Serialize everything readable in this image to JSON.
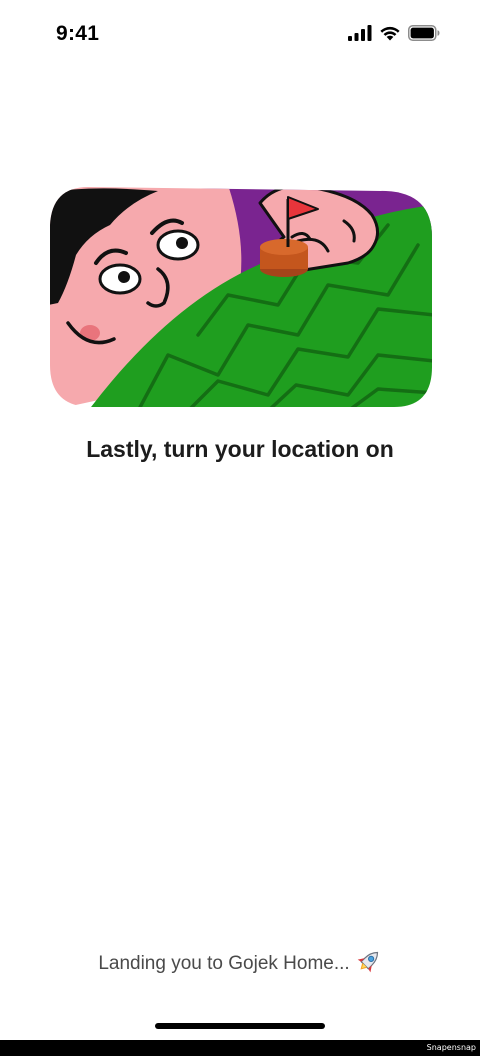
{
  "status_bar": {
    "time": "9:41",
    "icons": [
      "cellular-signal-icon",
      "wifi-icon",
      "battery-icon"
    ]
  },
  "illustration": {
    "icon": "location-illustration",
    "colors": {
      "green": "#1f9e1f",
      "pink": "#f6a9ad",
      "purple": "#7a2490",
      "hair": "#111111",
      "flag": "#e8353b",
      "stand": "#c4561d"
    }
  },
  "headline": "Lastly, turn your location on",
  "landing": {
    "text": "Landing you to Gojek Home...",
    "icon": "rocket-icon"
  },
  "watermark": "Snapensnap"
}
